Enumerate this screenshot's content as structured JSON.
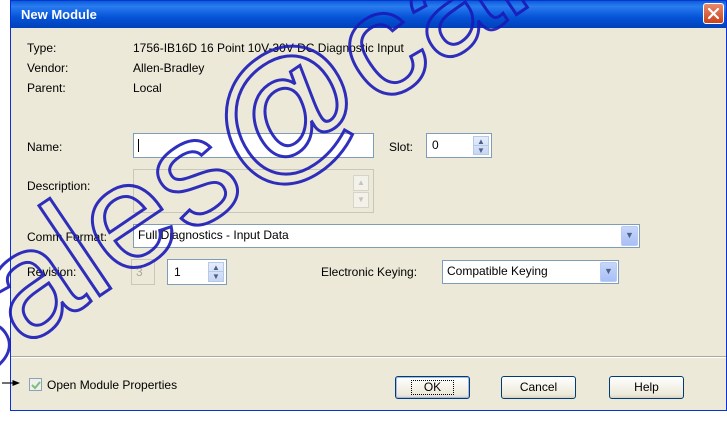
{
  "window": {
    "title": "New Module"
  },
  "info": {
    "type_label": "Type:",
    "type_value": "1756-IB16D 16 Point 10V-30V DC Diagnostic Input",
    "vendor_label": "Vendor:",
    "vendor_value": "Allen-Bradley",
    "parent_label": "Parent:",
    "parent_value": "Local"
  },
  "form": {
    "name_label": "Name:",
    "name_value": "",
    "slot_label": "Slot:",
    "slot_value": "0",
    "description_label": "Description:",
    "description_value": "",
    "comm_format_label": "Comm Format:",
    "comm_format_value": "Full Diagnostics - Input Data",
    "revision_label": "Revision:",
    "revision_major": "3",
    "revision_minor": "1",
    "keying_label": "Electronic Keying:",
    "keying_value": "Compatible Keying"
  },
  "footer": {
    "open_properties_label": "Open Module Properties",
    "open_properties_checked": true,
    "ok_label": "OK",
    "cancel_label": "Cancel",
    "help_label": "Help"
  },
  "watermark_text": "sales@camb",
  "colors": {
    "title_bar": "#0553d8",
    "close_button": "#c9421b",
    "dialog_bg": "#ece9d8",
    "watermark": "#1a1ab8"
  },
  "icons": {
    "close": "close-icon",
    "spin_up": "chevron-up-icon",
    "spin_down": "chevron-down-icon",
    "dropdown": "chevron-down-icon",
    "check": "checkmark-icon",
    "pointer": "arrow-pointer-icon"
  }
}
